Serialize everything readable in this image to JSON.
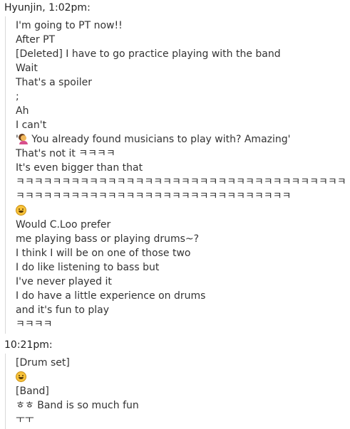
{
  "messages": [
    {
      "header": "Hyunjin, 1:02pm:",
      "lines": [
        "I'm going to PT now!!",
        "After PT",
        "[Deleted] I have to go practice playing with the band",
        "Wait",
        "That's a spoiler",
        ";",
        "Ah",
        "I can't",
        "' You already found musicians to play with? Amazing'",
        "That's not it ㅋㅋㅋㅋ",
        "It's even bigger than that",
        "ㅋㅋㅋㅋㅋㅋㅋㅋㅋㅋㅋㅋㅋㅋㅋㅋㅋㅋㅋㅋㅋㅋㅋㅋㅋㅋㅋㅋㅋㅋㅋㅋㅋㅋㅋㅋㅋ",
        "ㅋㅋㅋㅋㅋㅋㅋㅋㅋㅋㅋㅋㅋㅋㅋㅋㅋㅋㅋㅋㅋㅋㅋㅋㅋㅋㅋㅋㅋㅋ",
        "",
        "Would C.Loo prefer",
        "me playing bass or playing drums~?",
        "I think I will be on one of those two",
        "I do like listening to bass but",
        "I've never played it",
        "I do have a little experience on drums",
        "and it's fun to play",
        "ㅋㅋㅋㅋ"
      ]
    },
    {
      "header": "10:21pm:",
      "lines": [
        "[Drum set]",
        "",
        "[Band]",
        "ㅎㅎ Band is so much fun",
        "ㅜㅜ"
      ]
    }
  ],
  "icons": {
    "raising_hand": "person-raising-hand-icon",
    "grin_1": "grinning-squinting-face-icon",
    "grin_2": "grinning-face-icon"
  }
}
